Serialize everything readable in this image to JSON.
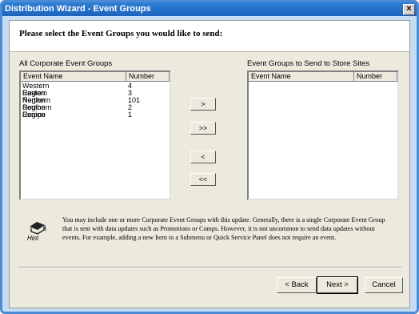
{
  "window": {
    "title": "Distribution Wizard - Event Groups",
    "close_glyph": "×"
  },
  "prompt": "Please select the Event Groups you would like to send:",
  "left_list": {
    "label": "All Corporate Event Groups",
    "col_name": "Event Name",
    "col_number": "Number",
    "rows": [
      {
        "name": "Western Region",
        "number": "4"
      },
      {
        "name": "Eastern Region",
        "number": "3"
      },
      {
        "name": "Northern Region",
        "number": "101"
      },
      {
        "name": "Southern Region",
        "number": "2"
      },
      {
        "name": "Europe",
        "number": "1"
      }
    ]
  },
  "right_list": {
    "label": "Event Groups to Send to Store Sites",
    "col_name": "Event Name",
    "col_number": "Number"
  },
  "transfer": {
    "add": ">",
    "add_all": ">>",
    "remove": "<",
    "remove_all": "<<"
  },
  "hint": {
    "icon_label": "Hint",
    "text": "You may include one or more Corporate Event Groups with this update. Generally, there is a single Corporate Event Group that is sent with data updates such as Promotions or Comps. However, it is not uncommon to send data updates without events. For example, adding a new Item to a Submenu or Quick Service Panel does not require an event."
  },
  "nav": {
    "back": "< Back",
    "next": "Next >",
    "cancel": "Cancel"
  }
}
